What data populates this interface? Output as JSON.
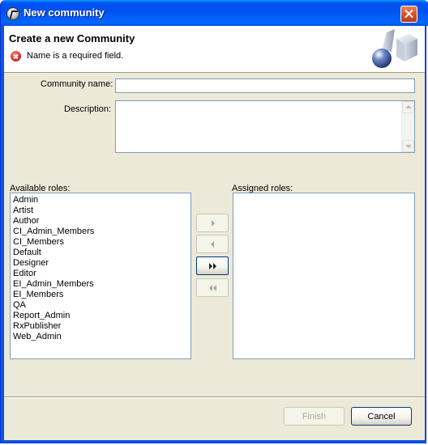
{
  "window": {
    "title": "New community",
    "title_icon": "wizard-app-icon",
    "close_icon": "close-icon"
  },
  "header": {
    "title": "Create a new Community",
    "error_message": "Name is a required field.",
    "error_icon": "error-icon",
    "graphic": "cube-sphere-wizard-graphic"
  },
  "form": {
    "community_name_label": "Community name:",
    "community_name_value": "",
    "description_label": "Description:",
    "description_value": ""
  },
  "roles": {
    "available_label": "Available roles:",
    "assigned_label": "Assigned roles:",
    "available": [
      "Admin",
      "Artist",
      "Author",
      "CI_Admin_Members",
      "CI_Members",
      "Default",
      "Designer",
      "Editor",
      "EI_Admin_Members",
      "EI_Members",
      "QA",
      "Report_Admin",
      "RxPublisher",
      "Web_Admin"
    ],
    "assigned": [],
    "buttons": {
      "add": "arrow-right-icon",
      "remove": "arrow-left-icon",
      "add_all": "double-arrow-right-icon",
      "remove_all": "double-arrow-left-icon"
    }
  },
  "footer": {
    "finish_label": "Finish",
    "cancel_label": "Cancel",
    "finish_enabled": false
  },
  "colors": {
    "titlebar": "#0053ee",
    "dialog_bg": "#ece9d8",
    "field_border": "#7f9db9",
    "error": "#e0302a"
  }
}
